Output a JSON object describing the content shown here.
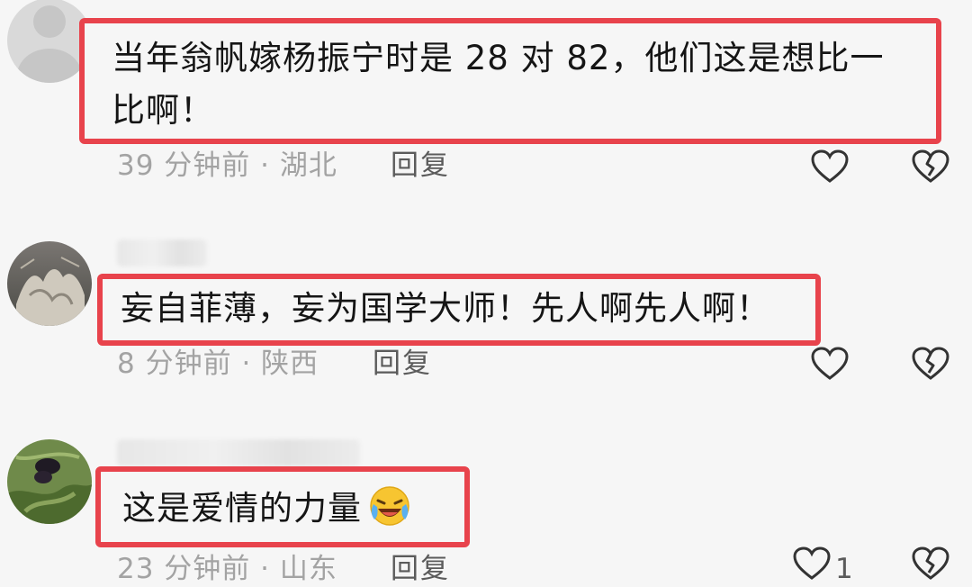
{
  "comments": [
    {
      "text_line1": "当年翁帆嫁杨振宁时是 28 对 82，他们这是想比一",
      "text_line2": "比啊！",
      "time": "39 分钟前",
      "region": "湖北",
      "reply_label": "回复",
      "like_icon": "heart-outline-icon",
      "dislike_icon": "broken-heart-icon"
    },
    {
      "text": "妄自菲薄，妄为国学大师！先人啊先人啊！",
      "time": "8 分钟前",
      "region": "陕西",
      "reply_label": "回复",
      "like_icon": "heart-outline-icon",
      "dislike_icon": "broken-heart-icon"
    },
    {
      "text": "这是爱情的力量",
      "emoji": "laughing-crying-emoji",
      "time": "23 分钟前",
      "region": "山东",
      "reply_label": "回复",
      "like_count": "1",
      "like_icon": "heart-outline-icon",
      "dislike_icon": "broken-heart-icon"
    }
  ],
  "meta_separator": "·",
  "colors": {
    "highlight_border": "#e8434c",
    "meta_text": "#a3a3a3",
    "reply_text": "#5b5b5b",
    "body_text": "#151515"
  }
}
